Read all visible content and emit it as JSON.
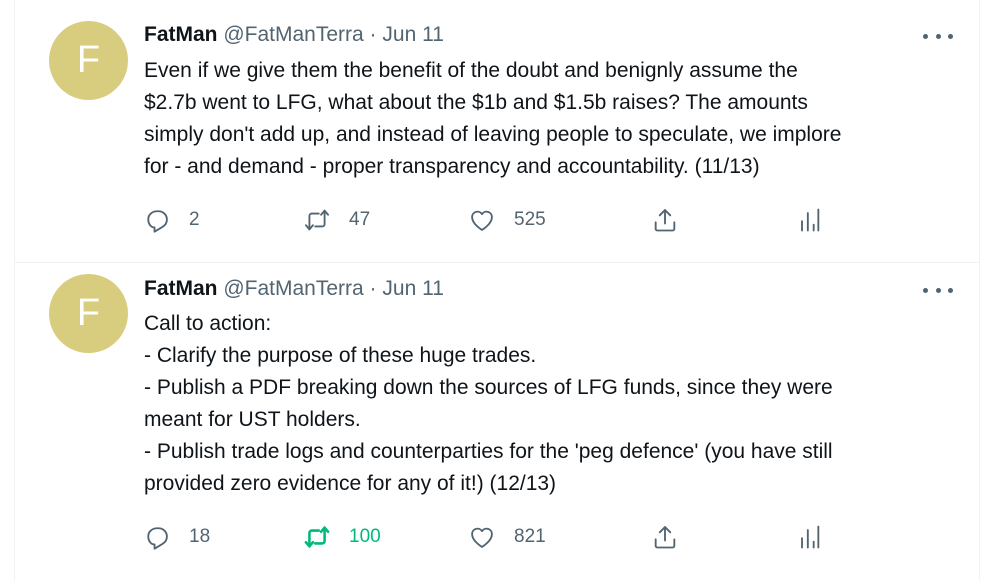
{
  "tweets": [
    {
      "avatar_letter": "F",
      "name": "FatMan",
      "handle": "@FatManTerra",
      "separator": "·",
      "date": "Jun 11",
      "lines": [
        "Even if we give them the benefit of the doubt and benignly assume the",
        "$2.7b went to LFG, what about the $1b and $1.5b raises? The amounts",
        "simply don't add up, and instead of leaving people to speculate, we implore",
        "for - and demand - proper transparency and accountability. (11/13)"
      ],
      "replies": "2",
      "retweets": "47",
      "likes": "525",
      "retweeted": false
    },
    {
      "avatar_letter": "F",
      "name": "FatMan",
      "handle": "@FatManTerra",
      "separator": "·",
      "date": "Jun 11",
      "lines": [
        "Call to action:",
        "- Clarify the purpose of these huge trades.",
        "- Publish a PDF breaking down the sources of LFG funds, since they were",
        "meant for UST holders.",
        "- Publish trade logs and counterparties for the 'peg defence' (you have still",
        "provided zero evidence for any of it!) (12/13)"
      ],
      "replies": "18",
      "retweets": "100",
      "likes": "821",
      "retweeted": true
    }
  ],
  "icons": {
    "reply": "reply-icon",
    "retweet": "retweet-icon",
    "like": "heart-icon",
    "share": "share-icon",
    "analytics": "analytics-icon",
    "more": "more-icon"
  },
  "colors": {
    "icon_gray": "#536471",
    "retweet_green": "#00ba7c",
    "avatar_bg": "#d8cd7f"
  }
}
